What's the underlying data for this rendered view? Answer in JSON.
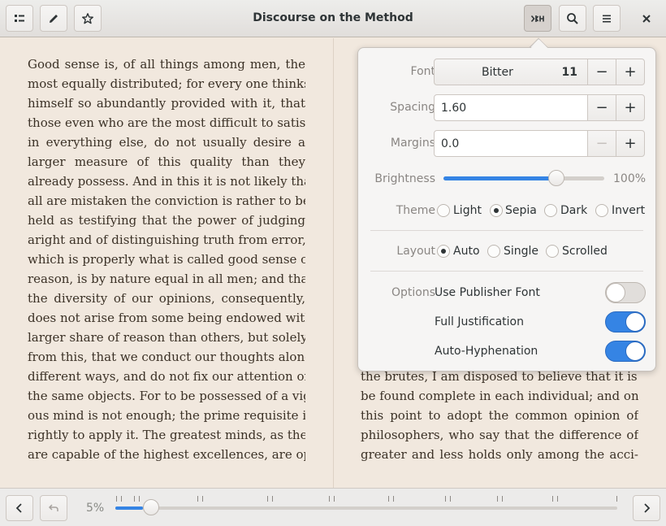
{
  "window": {
    "title": "Discourse on the Method"
  },
  "header": {
    "left_buttons": [
      "contents-icon",
      "pencil-icon",
      "star-icon"
    ],
    "right_buttons": [
      "view-settings-icon",
      "search-icon",
      "menu-icon",
      "close-icon"
    ]
  },
  "page": {
    "left_lines": [
      "Good sense is, of all things among men, the",
      "most equally distributed; for every one thinks",
      "himself so abundantly provided with it, that",
      "those even who are the most difficult to satisfy",
      "in everything else, do not usually desire a",
      "larger measure of this quality than they",
      "already possess. And in this it is not likely that",
      "all are mistaken the conviction is rather to be",
      "held as testifying that the power of judging",
      "aright and of distinguishing truth from error,",
      "which is properly what is called good sense or",
      "reason, is by nature equal in all men; and that",
      "the diversity of our opinions, consequently,",
      "does not arise from some being endowed with a",
      "larger share of reason than others, but solely",
      "from this, that we conduct our thoughts along",
      "different ways, and do not fix our attention on",
      "the same objects. For to be possessed of a vigor-",
      "ous mind is not enough; the prime requisite is",
      "rightly to apply it. The greatest minds, as they",
      "are capable of the highest excellences, are open"
    ],
    "right_lines": [
      "the brutes, I am disposed to believe that it is to",
      "be found complete in each individual; and on",
      "this point to adopt the common opinion of",
      "philosophers, who say that the difference of",
      "greater and less holds only among the acci-"
    ]
  },
  "settings": {
    "font_label": "Font",
    "font_name": "Bitter",
    "font_size": "11",
    "spacing_label": "Spacing",
    "spacing_value": "1.60",
    "margins_label": "Margins",
    "margins_value": "0.0",
    "brightness_label": "Brightness",
    "brightness_value": "100%",
    "brightness_level": 0.7,
    "theme_label": "Theme",
    "themes": [
      "Light",
      "Sepia",
      "Dark",
      "Invert"
    ],
    "theme_selected": "Sepia",
    "layout_label": "Layout",
    "layouts": [
      "Auto",
      "Single",
      "Scrolled"
    ],
    "layout_selected": "Auto",
    "options_label": "Options",
    "options": [
      {
        "label": "Use Publisher Font",
        "on": false
      },
      {
        "label": "Full Justification",
        "on": true
      },
      {
        "label": "Auto-Hyphenation",
        "on": true
      }
    ]
  },
  "bottom": {
    "progress_label": "5%",
    "progress": 0.05
  }
}
